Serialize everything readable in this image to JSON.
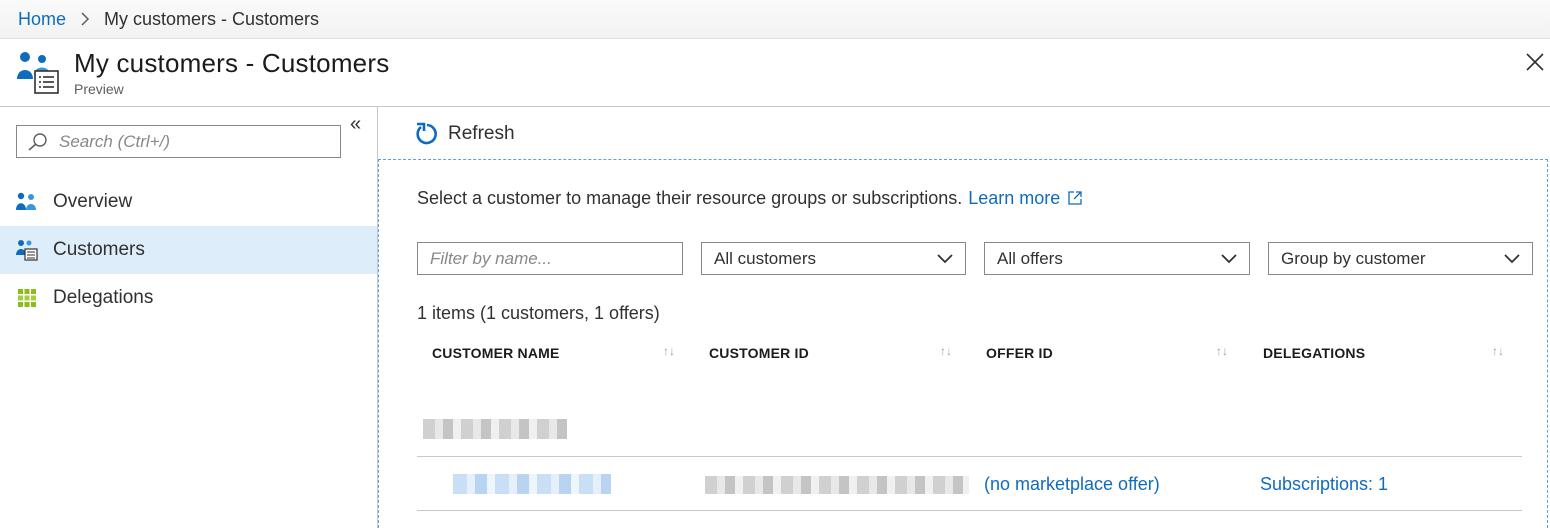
{
  "breadcrumb": {
    "home": "Home",
    "current": "My customers - Customers"
  },
  "header": {
    "title": "My customers - Customers",
    "subtitle": "Preview"
  },
  "sidebar": {
    "search_placeholder": "Search (Ctrl+/)",
    "items": [
      {
        "label": "Overview",
        "icon": "overview-icon",
        "active": false
      },
      {
        "label": "Customers",
        "icon": "customers-icon",
        "active": true
      },
      {
        "label": "Delegations",
        "icon": "delegations-icon",
        "active": false
      }
    ]
  },
  "toolbar": {
    "refresh_label": "Refresh"
  },
  "main": {
    "description": "Select a customer to manage their resource groups or subscriptions.",
    "learn_more": "Learn more",
    "filter_placeholder": "Filter by name...",
    "customers_select": "All customers",
    "offers_select": "All offers",
    "group_select": "Group by customer",
    "items_count": "1 items (1 customers, 1 offers)",
    "columns": [
      "CUSTOMER NAME",
      "CUSTOMER ID",
      "OFFER ID",
      "DELEGATIONS"
    ],
    "row": {
      "offer_id": "(no marketplace offer)",
      "delegations": "Subscriptions: 1"
    }
  },
  "colors": {
    "accent": "#0f6cbd",
    "selected_bg": "#ddeefa",
    "border": "#8a8886"
  }
}
